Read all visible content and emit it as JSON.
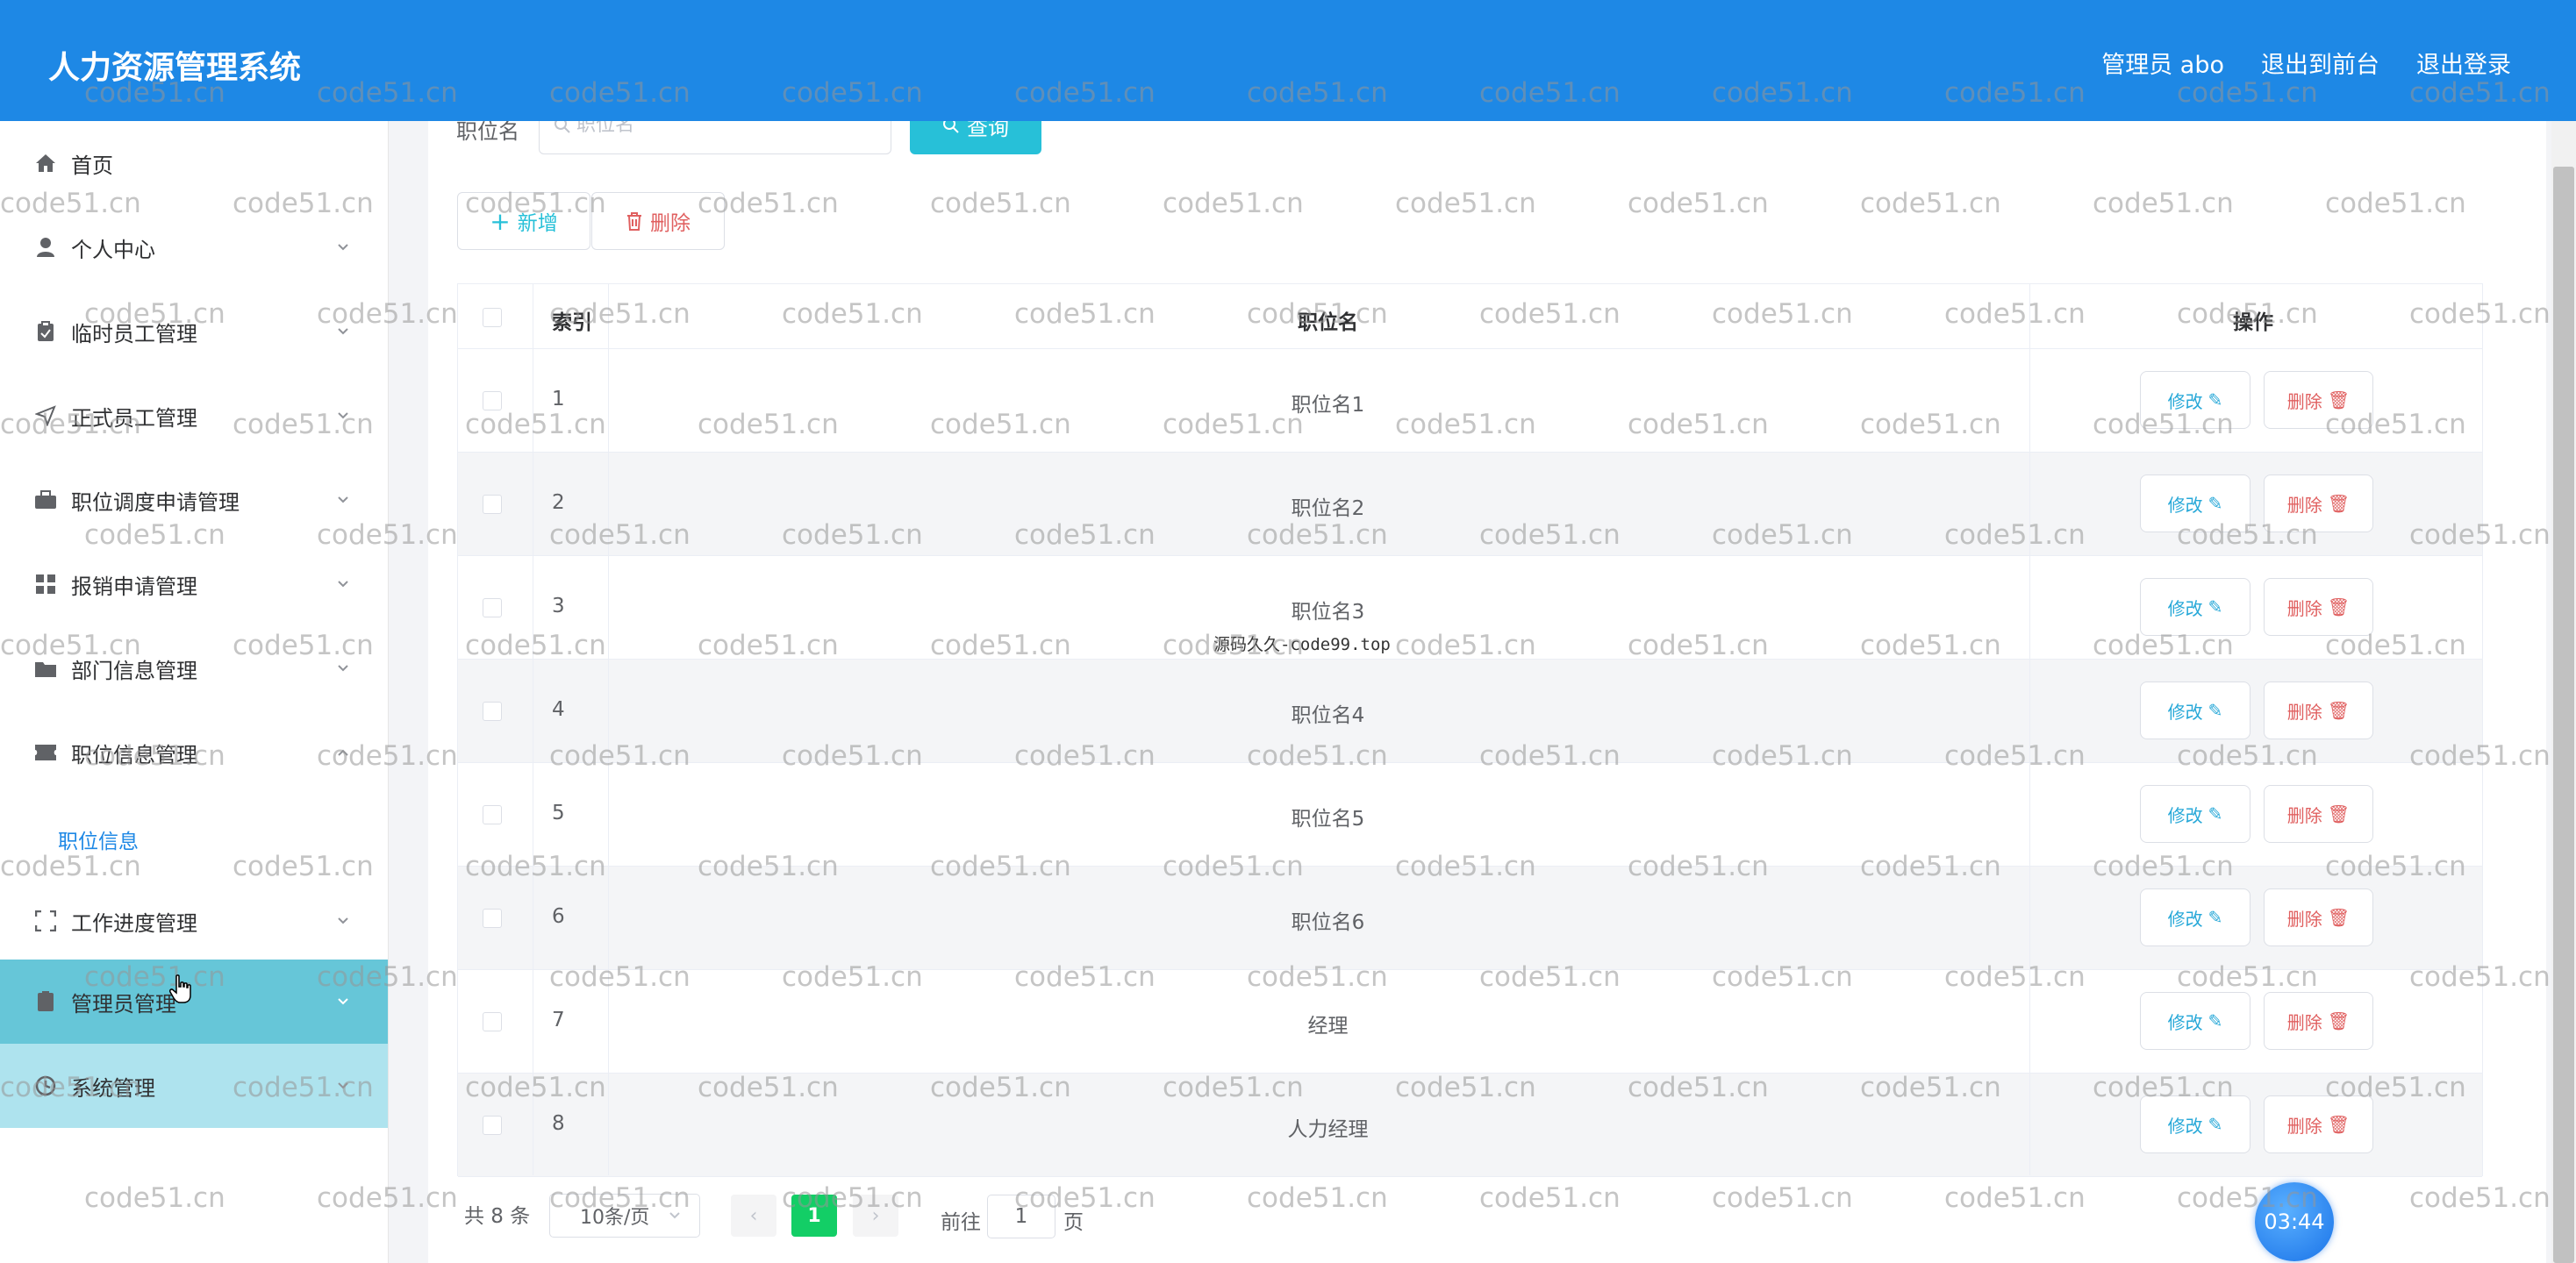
{
  "header": {
    "title": "人力资源管理系统",
    "user": "管理员 abo",
    "back_to_front": "退出到前台",
    "logout": "退出登录"
  },
  "sidebar": {
    "items": [
      {
        "label": "首页",
        "icon": "home-icon"
      },
      {
        "label": "个人中心",
        "icon": "user-icon"
      },
      {
        "label": "临时员工管理",
        "icon": "clipboard-icon"
      },
      {
        "label": "正式员工管理",
        "icon": "send-icon"
      },
      {
        "label": "职位调度申请管理",
        "icon": "briefcase-icon"
      },
      {
        "label": "报销申请管理",
        "icon": "grid-icon"
      },
      {
        "label": "部门信息管理",
        "icon": "folder-icon"
      },
      {
        "label": "职位信息管理",
        "icon": "ticket-icon"
      },
      {
        "label": "工作进度管理",
        "icon": "frame-icon"
      },
      {
        "label": "管理员管理",
        "icon": "document-icon"
      },
      {
        "label": "系统管理",
        "icon": "clock-icon"
      }
    ],
    "submenu_active": "职位信息"
  },
  "search": {
    "label": "职位名",
    "placeholder": "职位名",
    "button": "查询"
  },
  "toolbar": {
    "add": "新增",
    "delete": "删除"
  },
  "table": {
    "columns": [
      "索引",
      "职位名",
      "操作"
    ],
    "rows": [
      {
        "index": "1",
        "name": "职位名1"
      },
      {
        "index": "2",
        "name": "职位名2"
      },
      {
        "index": "3",
        "name": "职位名3"
      },
      {
        "index": "4",
        "name": "职位名4"
      },
      {
        "index": "5",
        "name": "职位名5"
      },
      {
        "index": "6",
        "name": "职位名6"
      },
      {
        "index": "7",
        "name": "经理"
      },
      {
        "index": "8",
        "name": "人力经理"
      }
    ],
    "edit_label": "修改",
    "delete_label": "删除"
  },
  "pagination": {
    "total": "共 8 条",
    "page_size": "10条/页",
    "current_page": "1",
    "goto_label": "前往",
    "goto_value": "1",
    "goto_suffix": "页"
  },
  "clock": "03:44",
  "stamp": "源码久久-code99.top",
  "watermark": "code51.cn",
  "colors": {
    "header": "#1e88e5",
    "accent": "#27c0d8",
    "danger": "#e06060",
    "page_active": "#13ce66"
  }
}
